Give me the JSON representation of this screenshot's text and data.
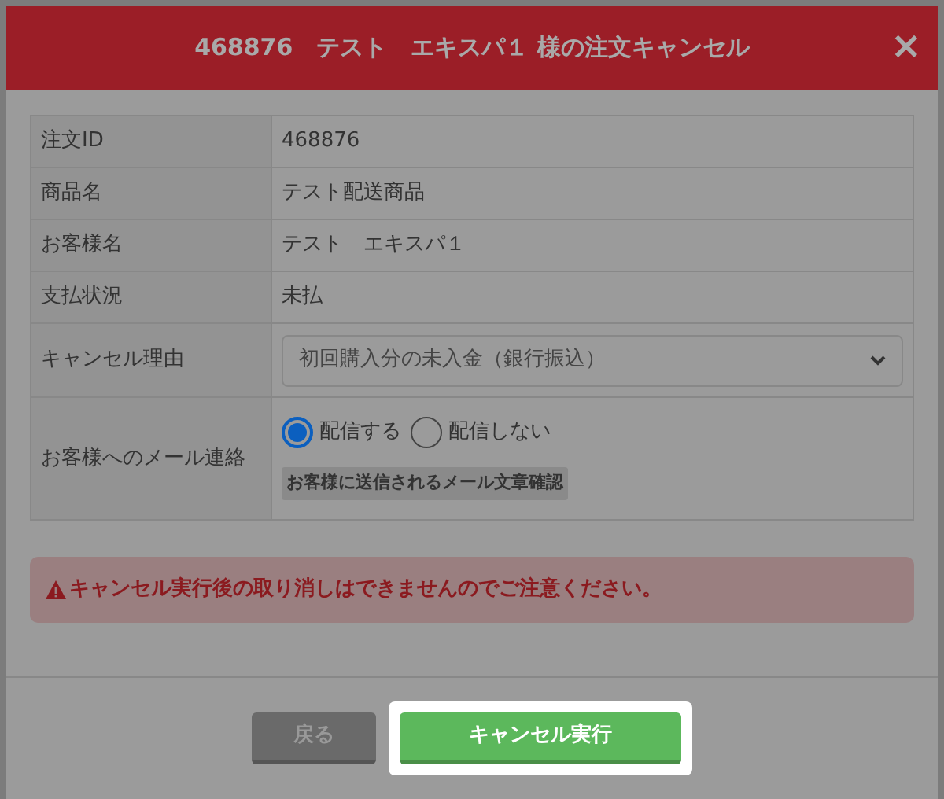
{
  "dialog": {
    "title": "468876　テスト　エキスパ１ 様の注文キャンセル",
    "close": "×"
  },
  "table": {
    "rows": [
      {
        "kind": "text",
        "label": "注文ID",
        "value": "468876"
      },
      {
        "kind": "text",
        "label": "商品名",
        "value": "テスト配送商品"
      },
      {
        "kind": "text",
        "label": "お客様名",
        "value": "テスト　エキスパ１"
      },
      {
        "kind": "text",
        "label": "支払状況",
        "value": "未払"
      },
      {
        "kind": "select",
        "label": "キャンセル理由",
        "value": "初回購入分の未入金（銀行振込）"
      },
      {
        "kind": "radio",
        "label": "お客様へのメール連絡",
        "options": [
          {
            "label": "配信する",
            "selected": true
          },
          {
            "label": "配信しない",
            "selected": false
          }
        ],
        "button": "お客様に送信されるメール文章確認"
      }
    ]
  },
  "warning": "キャンセル実行後の取り消しはできませんのでご注意ください。",
  "buttons": [
    {
      "kind": "back",
      "label": "戻る",
      "highlighted": false
    },
    {
      "kind": "primary",
      "label": "キャンセル実行",
      "highlighted": true
    }
  ]
}
